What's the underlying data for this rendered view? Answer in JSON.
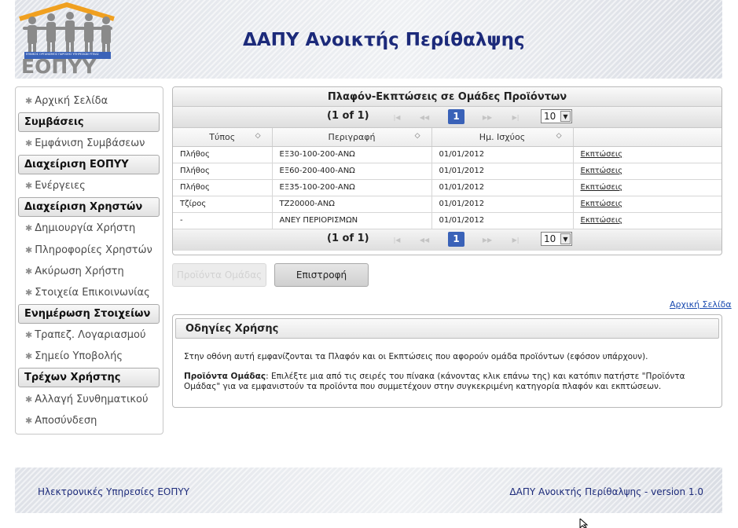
{
  "header": {
    "logo_text": "ΕΟΠΥΥ",
    "logo_caption": "ΕΘΝΙΚΟΣ ΟΡΓΑΝΙΣΜΟΣ ΠΑΡΟΧΗΣ ΥΠΗΡΕΣΙΩΝ ΥΓΕΙΑΣ",
    "title": "ΔΑΠΥ Ανοικτής Περίθαλψης"
  },
  "sidebar": {
    "home": "Αρχική Σελίδα",
    "sections": [
      {
        "title": "Συμβάσεις",
        "items": [
          "Εμφάνιση Συμβάσεων"
        ]
      },
      {
        "title": "Διαχείριση ΕΟΠΥΥ",
        "items": [
          "Ενέργειες"
        ]
      },
      {
        "title": "Διαχείριση Χρηστών",
        "items": [
          "Δημιουργία Χρήστη",
          "Πληροφορίες Χρηστών",
          "Ακύρωση Χρήστη",
          "Στοιχεία Επικοινωνίας"
        ]
      },
      {
        "title": "Ενημέρωση Στοιχείων",
        "items": [
          "Τραπεζ. Λογαριασμού",
          "Σημείο Υποβολής"
        ]
      },
      {
        "title": "Τρέχων Χρήστης",
        "items": [
          "Αλλαγή Συνθηματικού",
          "Αποσύνδεση"
        ]
      }
    ]
  },
  "grid": {
    "title": "Πλαφόν-Εκπτώσεις σε Ομάδες Προϊόντων",
    "paginator": {
      "label": "(1 of 1)",
      "current_page": "1",
      "rows_per_page": "10"
    },
    "columns": [
      "Τύπος",
      "Περιγραφή",
      "Ημ. Ισχύος",
      ""
    ],
    "rows": [
      {
        "type": "Πλήθος",
        "description": "ΕΞ30-100-200-ΑΝΩ",
        "date": "01/01/2012",
        "link": "Εκπτώσεις"
      },
      {
        "type": "Πλήθος",
        "description": "ΕΞ60-200-400-ΑΝΩ",
        "date": "01/01/2012",
        "link": "Εκπτώσεις"
      },
      {
        "type": "Πλήθος",
        "description": "ΕΞ35-100-200-ΑΝΩ",
        "date": "01/01/2012",
        "link": "Εκπτώσεις"
      },
      {
        "type": "Τζίρος",
        "description": "ΤΖ20000-ΑΝΩ",
        "date": "01/01/2012",
        "link": "Εκπτώσεις"
      },
      {
        "type": "-",
        "description": "ΑΝΕΥ ΠΕΡΙΟΡΙΣΜΩΝ",
        "date": "01/01/2012",
        "link": "Εκπτώσεις"
      }
    ]
  },
  "buttons": {
    "products": "Προϊόντα Ομάδας",
    "back": "Επιστροφή"
  },
  "home_link": "Αρχική Σελίδα",
  "help": {
    "title": "Οδηγίες Χρήσης",
    "paragraph1": "Στην οθόνη αυτή εμφανίζονται τα Πλαφόν και οι Εκπτώσεις που αφορούν ομάδα προϊόντων (εφόσον υπάρχουν).",
    "paragraph2_bold": "Προϊόντα Ομάδας",
    "paragraph2_colon": ":",
    "paragraph2_text": " Επιλέξτε μια από τις σειρές του πίνακα (κάνοντας κλικ επάνω της) και κατόπιν πατήστε \"Προϊόντα Ομάδας\" για να εμφανιστούν τα προϊόντα που συμμετέχουν στην συγκεκριμένη κατηγορία πλαφόν και εκπτώσεων."
  },
  "footer": {
    "left": "Ηλεκτρονικές Υπηρεσίες ΕΟΠΥΥ",
    "right": "ΔΑΠΥ Ανοικτής Περίθαλψης - version 1.0"
  },
  "colors": {
    "title_blue": "#1c2a7a",
    "page_button_blue": "#3a62b8",
    "logo_orange": "#f0a020",
    "logo_gray": "#8a8a8a"
  }
}
